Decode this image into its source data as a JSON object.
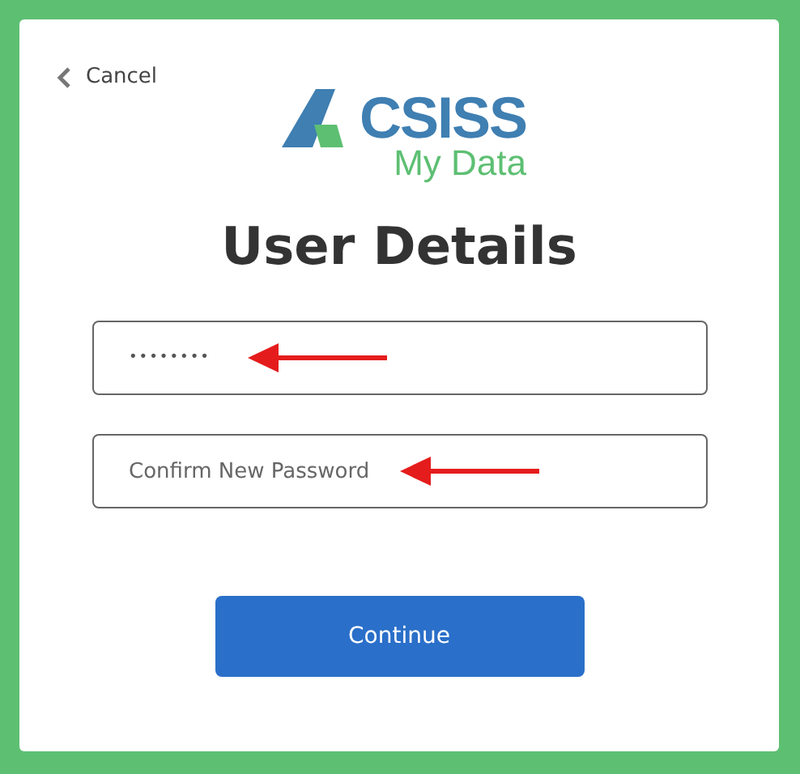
{
  "cancel": {
    "label": "Cancel"
  },
  "logo": {
    "wordmark": "CSISS",
    "subtitle": "My Data"
  },
  "title": "User Details",
  "fields": [
    {
      "kind": "password",
      "value": "••••••••"
    },
    {
      "kind": "text",
      "placeholder": "Confirm New Password"
    }
  ],
  "button": {
    "label": "Continue"
  }
}
